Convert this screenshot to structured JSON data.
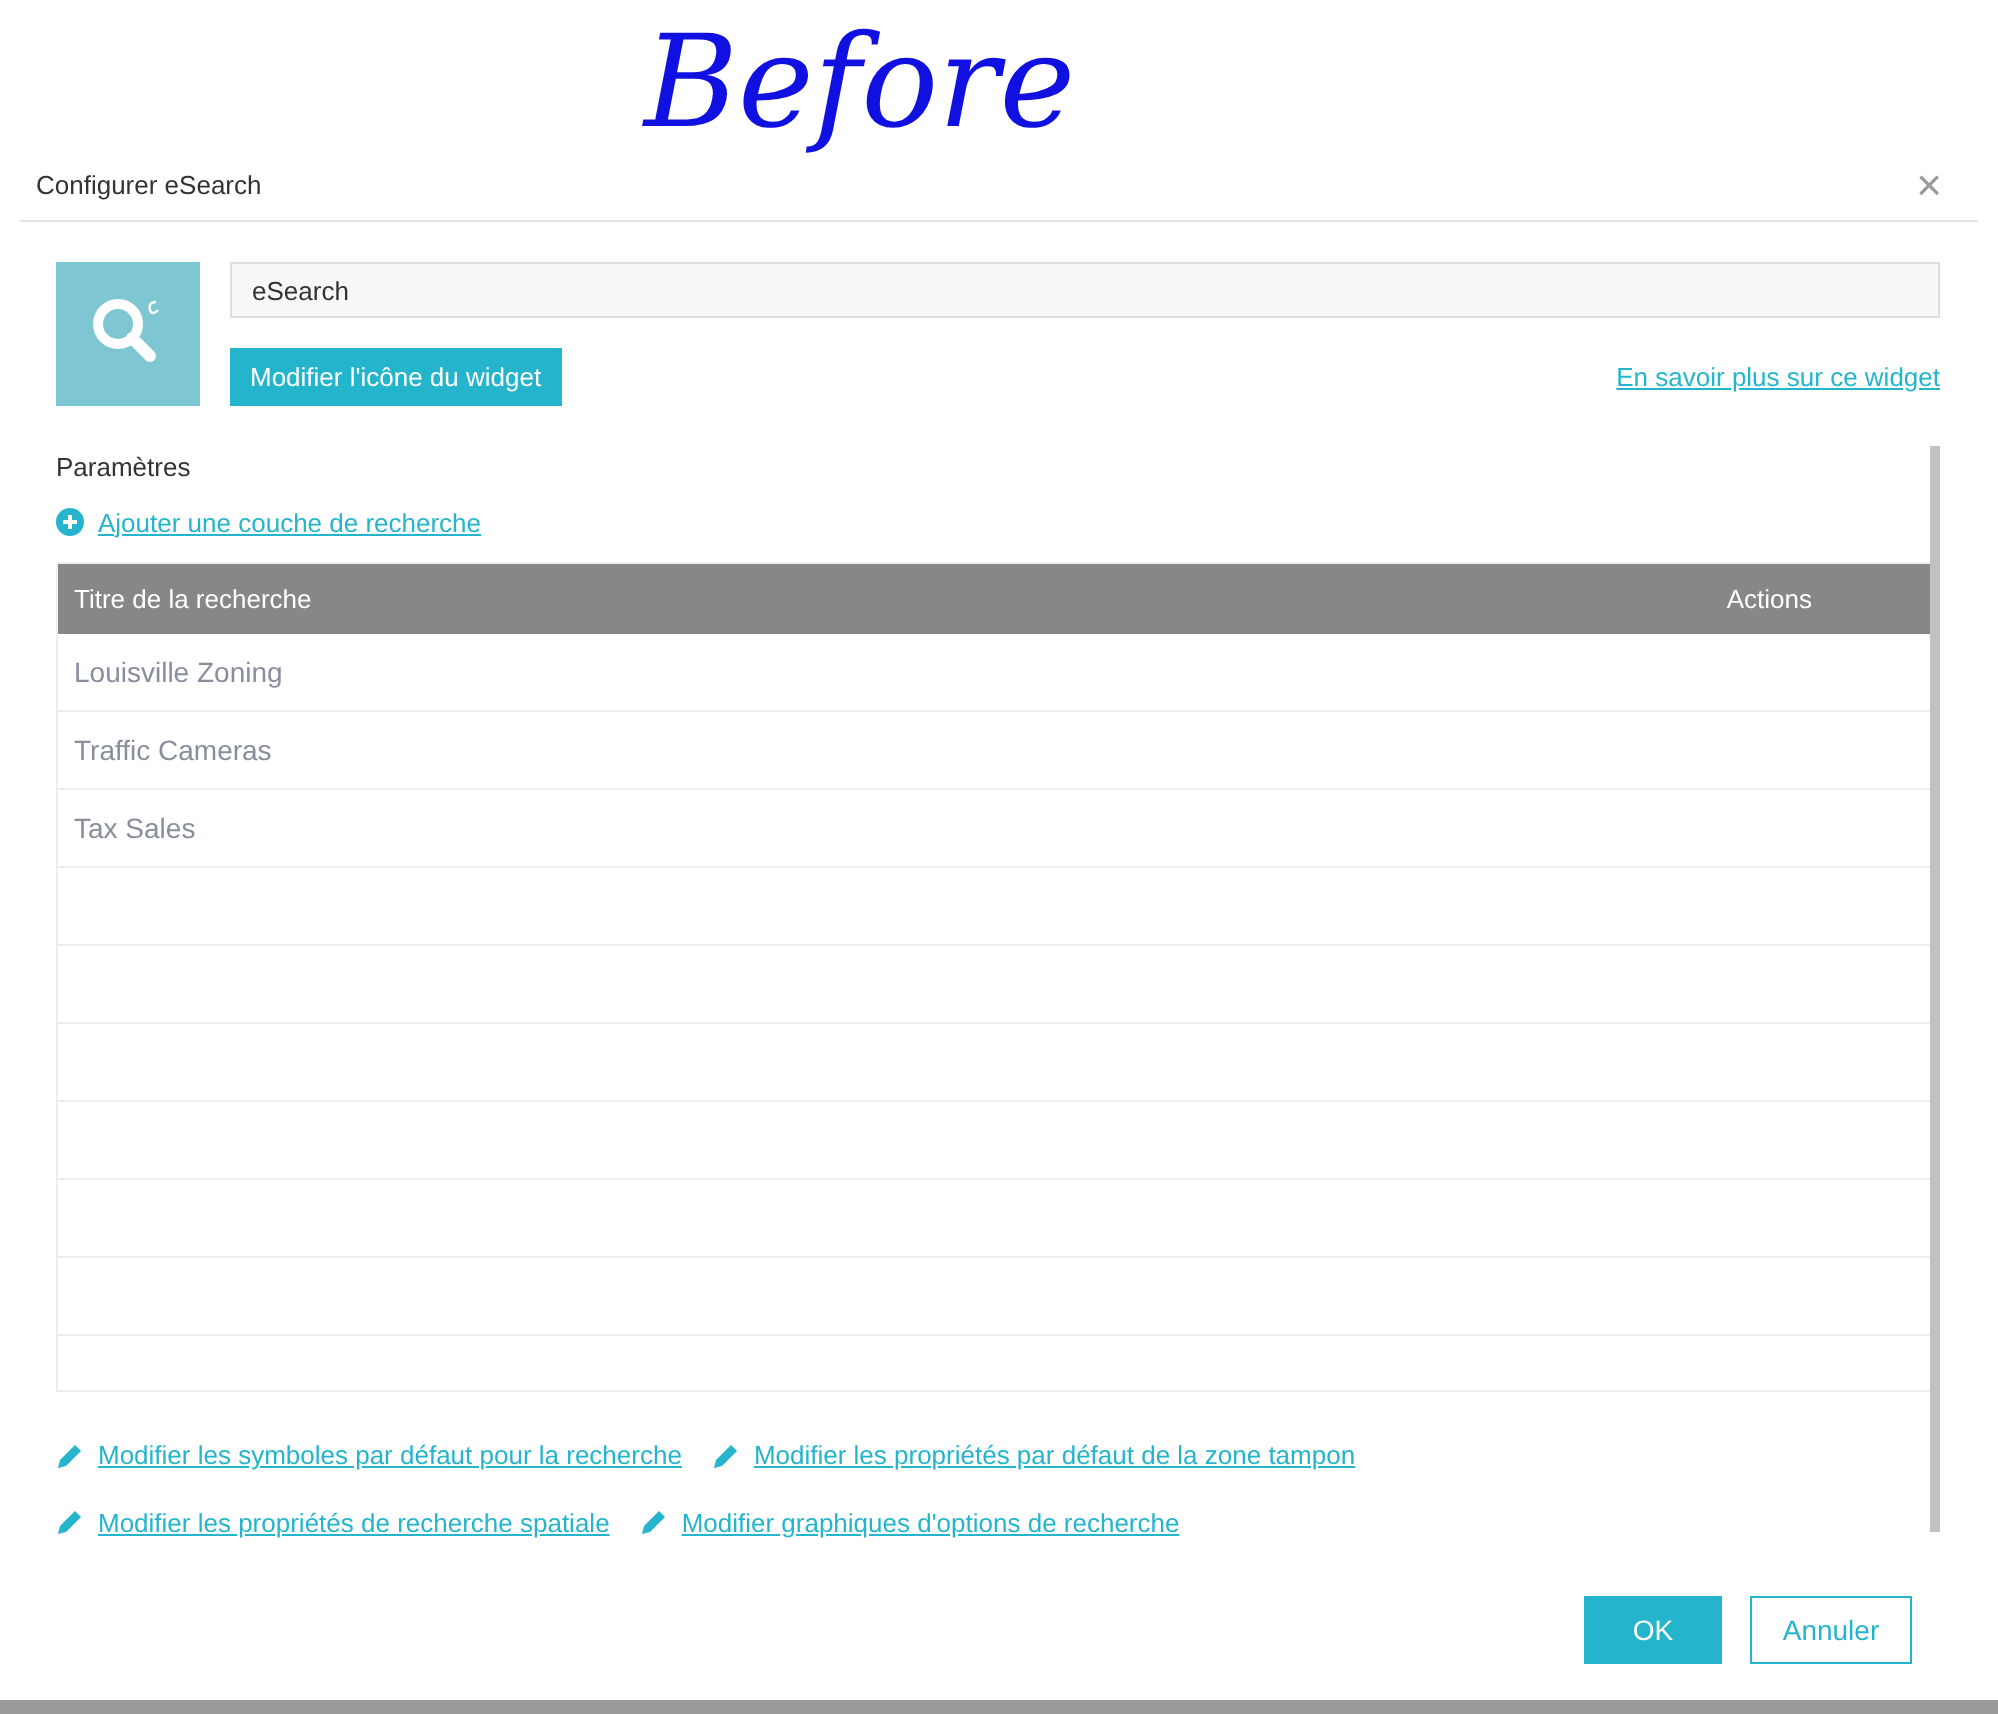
{
  "annotation": "Before",
  "dialog": {
    "title": "Configurer eSearch",
    "close": "×"
  },
  "widget": {
    "name_value": "eSearch",
    "change_icon_button": "Modifier l'icône du widget",
    "learn_more_link": "En savoir plus sur ce widget"
  },
  "settings": {
    "heading": "Paramètres",
    "add_layer_link": "Ajouter une couche de recherche",
    "table": {
      "columns": [
        "Titre de la recherche",
        "Actions"
      ],
      "rows": [
        {
          "title": "Louisville Zoning"
        },
        {
          "title": "Traffic Cameras"
        },
        {
          "title": "Tax Sales"
        }
      ]
    },
    "edit_links": [
      [
        "Modifier les symboles par défaut pour la recherche",
        "Modifier les propriétés par défaut de la zone tampon"
      ],
      [
        "Modifier les propriétés de recherche spatiale",
        "Modifier graphiques d'options de recherche"
      ]
    ]
  },
  "buttons": [
    {
      "label": "OK",
      "kind": "primary"
    },
    {
      "label": "Annuler",
      "kind": "secondary"
    }
  ]
}
